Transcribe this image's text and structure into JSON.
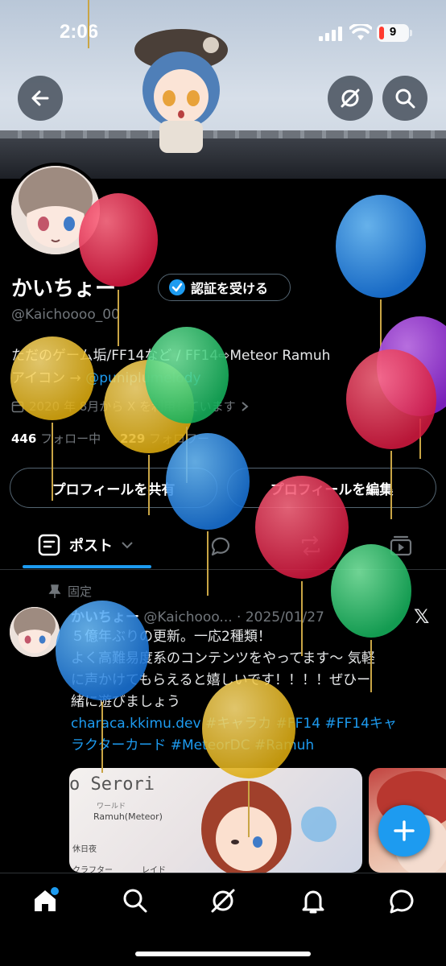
{
  "status_bar": {
    "time": "2:06",
    "battery_level": "9",
    "battery_color": "#ff3b30"
  },
  "header": {
    "back_icon": "arrow-left-icon",
    "grok_icon": "grok-icon",
    "search_icon": "search-icon"
  },
  "profile": {
    "display_name": "かいちょー",
    "verify_label": "認証を受ける",
    "handle": "@Kaichoooo_00",
    "bio_line1": "ただのゲーム垢/FF14など / FF14⇨Meteor Ramuh",
    "bio_line2_prefix": "アイコン → ",
    "bio_line2_link": "@puniplumelody",
    "joined": "2020 年 8月から X を利用しています",
    "following_count": "446",
    "following_label": "フォロー中",
    "followers_count": "229",
    "followers_label": "フォロワー",
    "share_button": "プロフィールを共有",
    "edit_button": "プロフィールを編集"
  },
  "tabs": {
    "posts_label": "ポスト"
  },
  "pinned_post": {
    "pinned_label": "固定",
    "author": "かいちょー",
    "handle": "@Kaichooo...",
    "date": "· 2025/01/27",
    "line1": "５億年ぶりの更新。一応2種類！",
    "line2": "よく高難易度系のコンテンツをやってます〜 気軽",
    "line3": "に声かけてもらえると嬉しいです！！！！ぜひー",
    "line4": "緒に遊びましょう",
    "link_line1": "characa.kkimu.dev #キャラカ #FF14 #FF14キャ",
    "link_line2": "ラクターカード #MeteorDC #Ramuh",
    "card_title": "o Serori",
    "card_world_label": "ワールド",
    "card_world": "Ramuh(Meteor)",
    "card_rest": "休日夜",
    "card_crafter": "クラフター",
    "card_raid": "レイド"
  },
  "colors": {
    "accent": "#1d9bf0",
    "background": "#000000",
    "muted": "#71767b",
    "border": "#2f3336"
  }
}
